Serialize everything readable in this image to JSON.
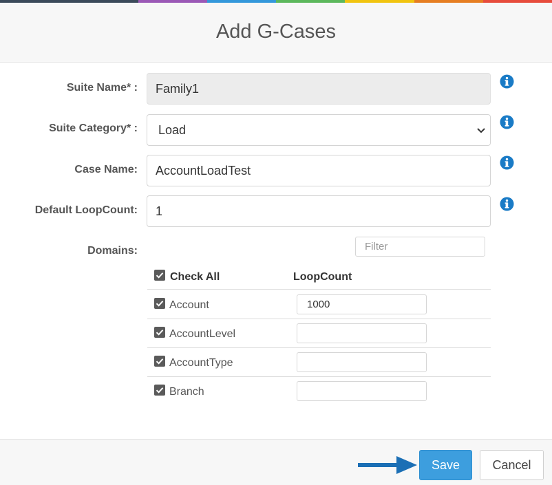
{
  "colors": {
    "top_bar": [
      "#3b4a5a",
      "#9b59b6",
      "#3498db",
      "#5cb85c",
      "#f1c40f",
      "#e67e22",
      "#e74c3c",
      "#c0392b"
    ],
    "info_icon": "#1a7bc6",
    "save_button": "#3d9ede",
    "arrow": "#1b6fb5"
  },
  "dialog": {
    "title": "Add G-Cases"
  },
  "form": {
    "suite_name": {
      "label": "Suite Name* :",
      "value": "Family1"
    },
    "suite_category": {
      "label": "Suite Category* :",
      "value": "Load"
    },
    "case_name": {
      "label": "Case Name:",
      "value": "AccountLoadTest"
    },
    "default_loopcount": {
      "label": "Default LoopCount:",
      "value": "1"
    },
    "domains": {
      "label": "Domains:",
      "filter_placeholder": "Filter",
      "header_check_all": "Check All",
      "header_loopcount": "LoopCount",
      "rows": [
        {
          "name": "Account",
          "checked": true,
          "loopcount": "1000"
        },
        {
          "name": "AccountLevel",
          "checked": true,
          "loopcount": ""
        },
        {
          "name": "AccountType",
          "checked": true,
          "loopcount": ""
        },
        {
          "name": "Branch",
          "checked": true,
          "loopcount": ""
        }
      ]
    }
  },
  "footer": {
    "save_label": "Save",
    "cancel_label": "Cancel"
  },
  "icons": {
    "info": "info-circle-icon",
    "chevron": "chevron-down-icon",
    "checkbox": "checkbox-checked-icon",
    "arrow": "arrow-right-icon"
  }
}
